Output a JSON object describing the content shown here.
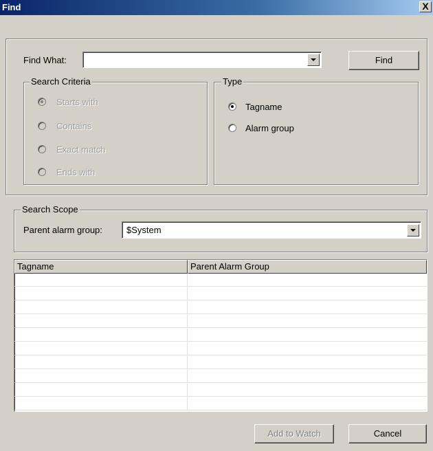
{
  "window": {
    "title": "Find",
    "close_label": "X"
  },
  "find": {
    "label": "Find What:",
    "value": "",
    "button_label": "Find"
  },
  "search_criteria": {
    "legend": "Search Criteria",
    "options": [
      {
        "label": "Starts with",
        "selected": true,
        "enabled": false
      },
      {
        "label": "Contains",
        "selected": false,
        "enabled": false
      },
      {
        "label": "Exact match",
        "selected": false,
        "enabled": false
      },
      {
        "label": "Ends with",
        "selected": false,
        "enabled": false
      }
    ]
  },
  "type": {
    "legend": "Type",
    "options": [
      {
        "label": "Tagname",
        "selected": true,
        "enabled": true
      },
      {
        "label": "Alarm group",
        "selected": false,
        "enabled": true
      }
    ]
  },
  "search_scope": {
    "legend": "Search Scope",
    "parent_label": "Parent alarm group:",
    "parent_value": "$System"
  },
  "results": {
    "columns": [
      "Tagname",
      "Parent Alarm Group"
    ],
    "rows": [
      [
        "",
        ""
      ],
      [
        "",
        ""
      ],
      [
        "",
        ""
      ],
      [
        "",
        ""
      ],
      [
        "",
        ""
      ],
      [
        "",
        ""
      ],
      [
        "",
        ""
      ],
      [
        "",
        ""
      ],
      [
        "",
        ""
      ],
      [
        "",
        ""
      ]
    ]
  },
  "footer": {
    "add_to_watch_label": "Add to Watch",
    "cancel_label": "Cancel"
  }
}
